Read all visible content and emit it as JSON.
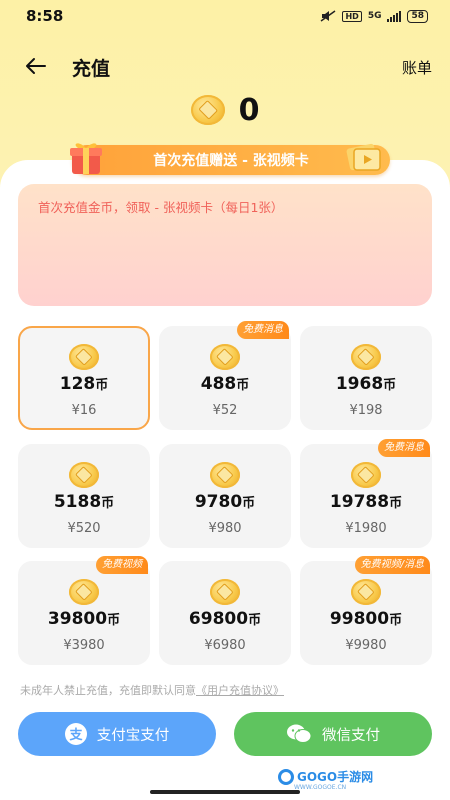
{
  "status_bar": {
    "time": "8:58",
    "hd": "HD",
    "network": "5G",
    "battery": "58"
  },
  "header": {
    "title": "充值",
    "bill_label": "账单"
  },
  "balance": {
    "value": "0"
  },
  "promo_banner": {
    "text": "首次充值赠送 - 张视频卡"
  },
  "promo_box": {
    "text": "首次充值金币，领取 - 张视频卡（每日1张）"
  },
  "packages": [
    {
      "amount": "128",
      "unit": "币",
      "price": "¥16",
      "badge": "",
      "selected": true
    },
    {
      "amount": "488",
      "unit": "币",
      "price": "¥52",
      "badge": "免费消息",
      "selected": false
    },
    {
      "amount": "1968",
      "unit": "币",
      "price": "¥198",
      "badge": "",
      "selected": false
    },
    {
      "amount": "5188",
      "unit": "币",
      "price": "¥520",
      "badge": "",
      "selected": false
    },
    {
      "amount": "9780",
      "unit": "币",
      "price": "¥980",
      "badge": "",
      "selected": false
    },
    {
      "amount": "19788",
      "unit": "币",
      "price": "¥1980",
      "badge": "免费消息",
      "selected": false
    },
    {
      "amount": "39800",
      "unit": "币",
      "price": "¥3980",
      "badge": "免费视频",
      "selected": false
    },
    {
      "amount": "69800",
      "unit": "币",
      "price": "¥6980",
      "badge": "",
      "selected": false
    },
    {
      "amount": "99800",
      "unit": "币",
      "price": "¥9980",
      "badge": "免费视频/消息",
      "selected": false
    }
  ],
  "agreement": {
    "text": "未成年人禁止充值，充值即默认同意",
    "link": "《用户充值协议》"
  },
  "payment": {
    "alipay_label": "支付宝支付",
    "wechat_label": "微信支付"
  },
  "watermark": {
    "brand": "GOGO手游网",
    "sub": "WWW.GOGOE.CN"
  },
  "colors": {
    "top_background": "#fdf1a6",
    "accent_orange": "#ff9a2e",
    "selected_border": "#f9a649",
    "promo_text": "#f0625a",
    "alipay": "#5ca5fa",
    "wechat": "#5fc45f"
  }
}
